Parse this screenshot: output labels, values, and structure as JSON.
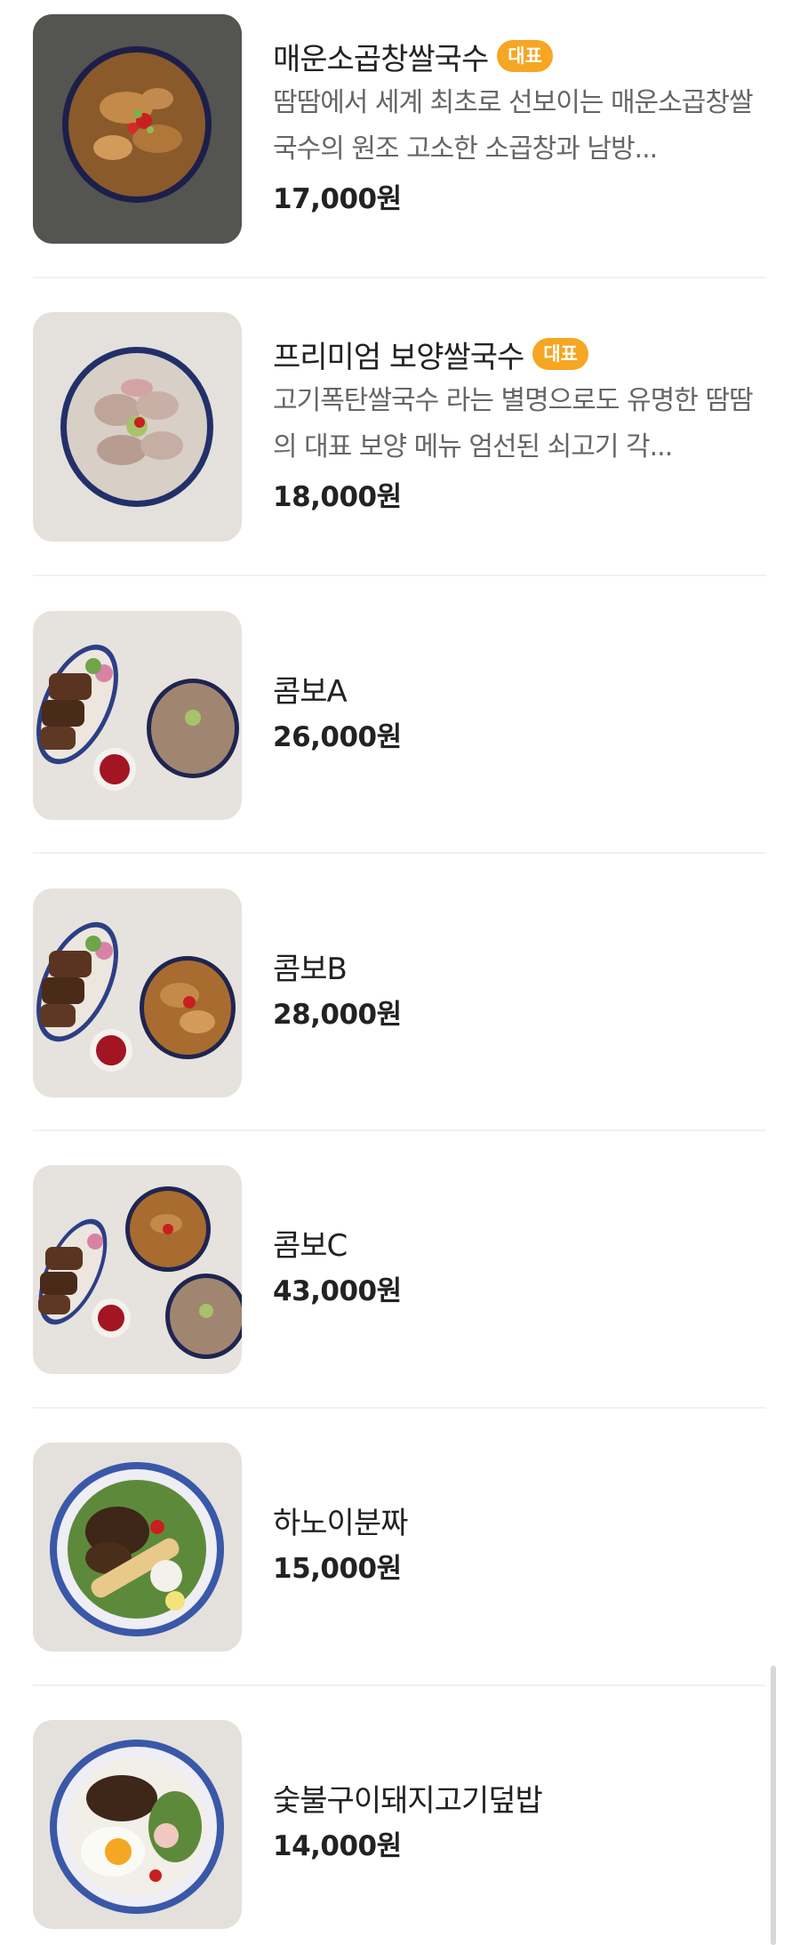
{
  "menu": {
    "items": [
      {
        "name": "매운소곱창쌀국수",
        "badge": "대표",
        "description": "땀땀에서 세계 최초로 선보이는 매운소곱창쌀국수의 원조 고소한 소곱창과 남방...",
        "price": "17,000원",
        "image": "spicy-tripe-noodle-bowl"
      },
      {
        "name": "프리미엄 보양쌀국수",
        "badge": "대표",
        "description": "고기폭탄쌀국수 라는 별명으로도 유명한 땀땀의 대표 보양 메뉴 엄선된 쇠고기 각...",
        "price": "18,000원",
        "image": "premium-beef-noodle-bowl"
      },
      {
        "name": "콤보A",
        "price": "26,000원",
        "image": "combo-a-platter"
      },
      {
        "name": "콤보B",
        "price": "28,000원",
        "image": "combo-b-platter"
      },
      {
        "name": "콤보C",
        "price": "43,000원",
        "image": "combo-c-platter"
      },
      {
        "name": "하노이분짜",
        "price": "15,000원",
        "image": "hanoi-bun-cha-plate"
      },
      {
        "name": "숯불구이돼지고기덮밥",
        "price": "14,000원",
        "image": "charcoal-pork-rice-plate"
      }
    ]
  },
  "colors": {
    "badge": "#f5a623",
    "divider": "#f1f1f1",
    "price": "#222222",
    "description": "#666666"
  }
}
